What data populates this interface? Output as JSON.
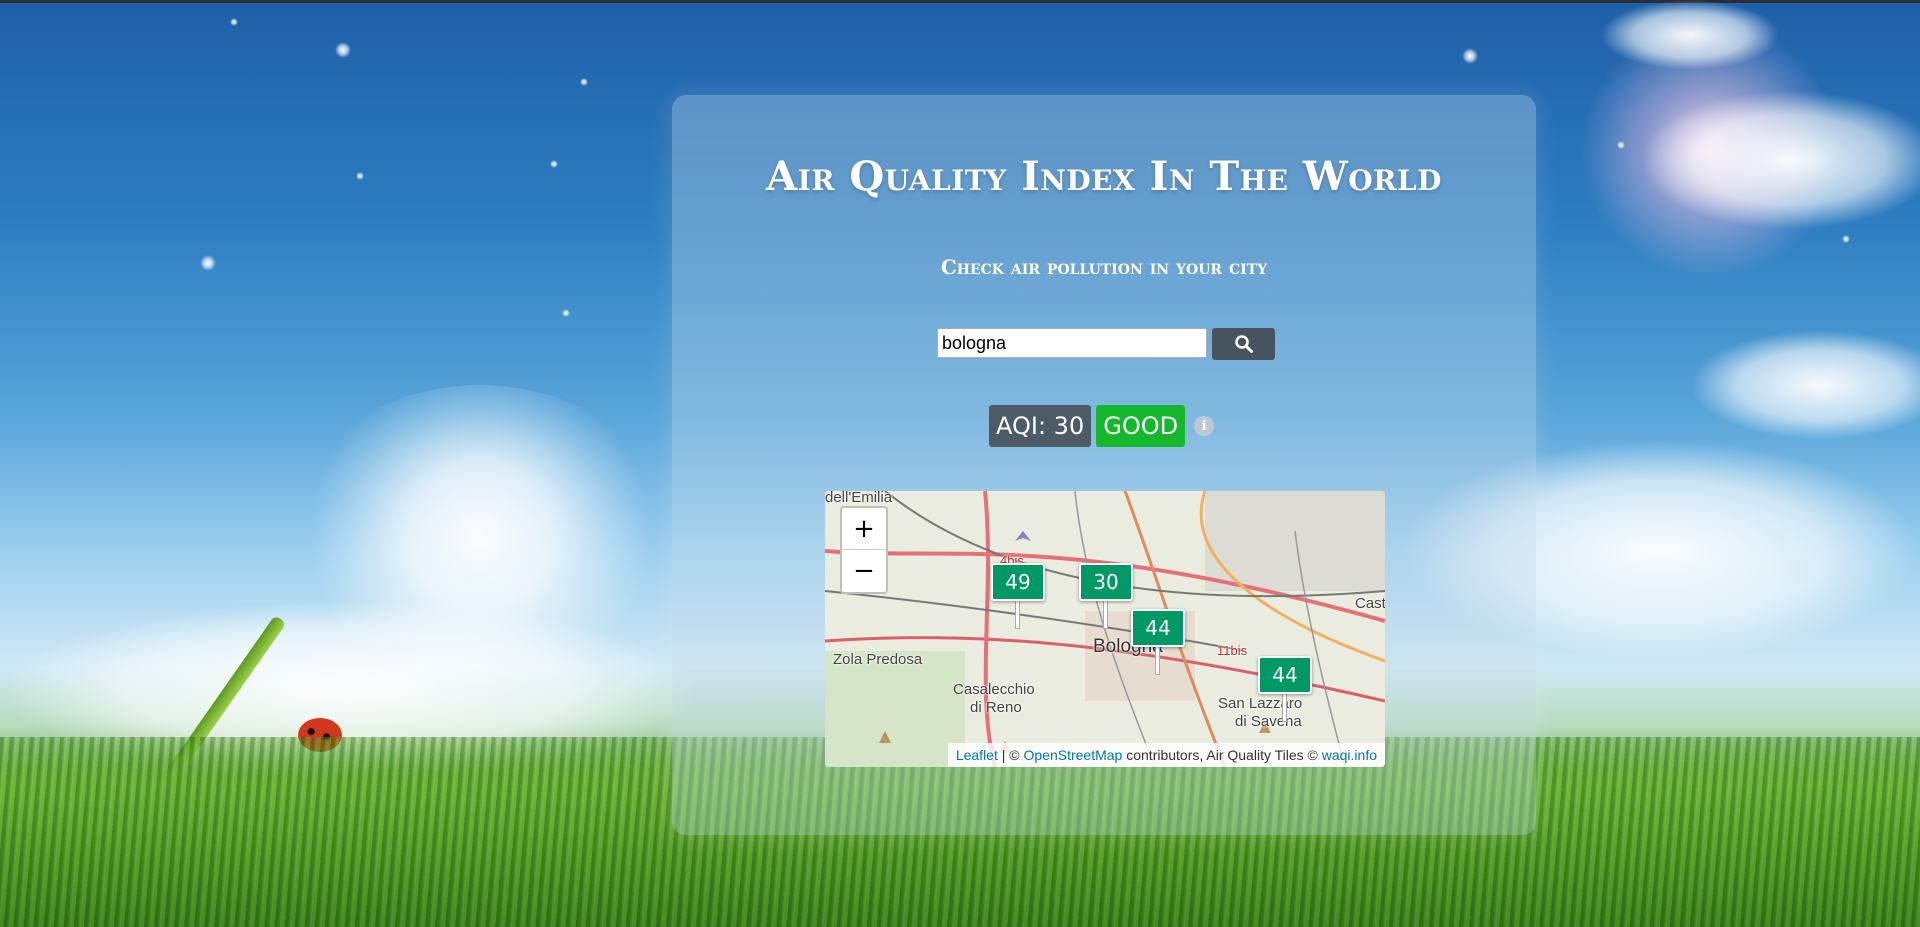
{
  "header": {
    "title": "Air Quality Index In The World",
    "subtitle": "Check air pollution in your city"
  },
  "search": {
    "value": "bologna",
    "button_icon": "search-icon"
  },
  "aqi": {
    "value_label": "AQI: 30",
    "level_label": "GOOD",
    "level_color": "#13b92a",
    "info_icon": "info-icon"
  },
  "map": {
    "zoom_in": "+",
    "zoom_out": "−",
    "places": {
      "emilia": "dell'Emilia",
      "zola": "Zola Predosa",
      "casalecchio_1": "Casalecchio",
      "casalecchio_2": "di Reno",
      "bologna": "Bologna",
      "lazzaro_1": "San Lazzaro",
      "lazzaro_2": "di Savena",
      "castel": "Cast",
      "road_4bis": "4bis",
      "road_11bis": "11bis"
    },
    "markers": [
      {
        "value": "49",
        "color": "#009966"
      },
      {
        "value": "30",
        "color": "#009966"
      },
      {
        "value": "44",
        "color": "#009966"
      },
      {
        "value": "44",
        "color": "#009966"
      }
    ],
    "attribution": {
      "leaflet": "Leaflet",
      "sep": " | © ",
      "osm": "OpenStreetMap",
      "text": " contributors, Air Quality Tiles © ",
      "waqi": "waqi.info"
    }
  }
}
